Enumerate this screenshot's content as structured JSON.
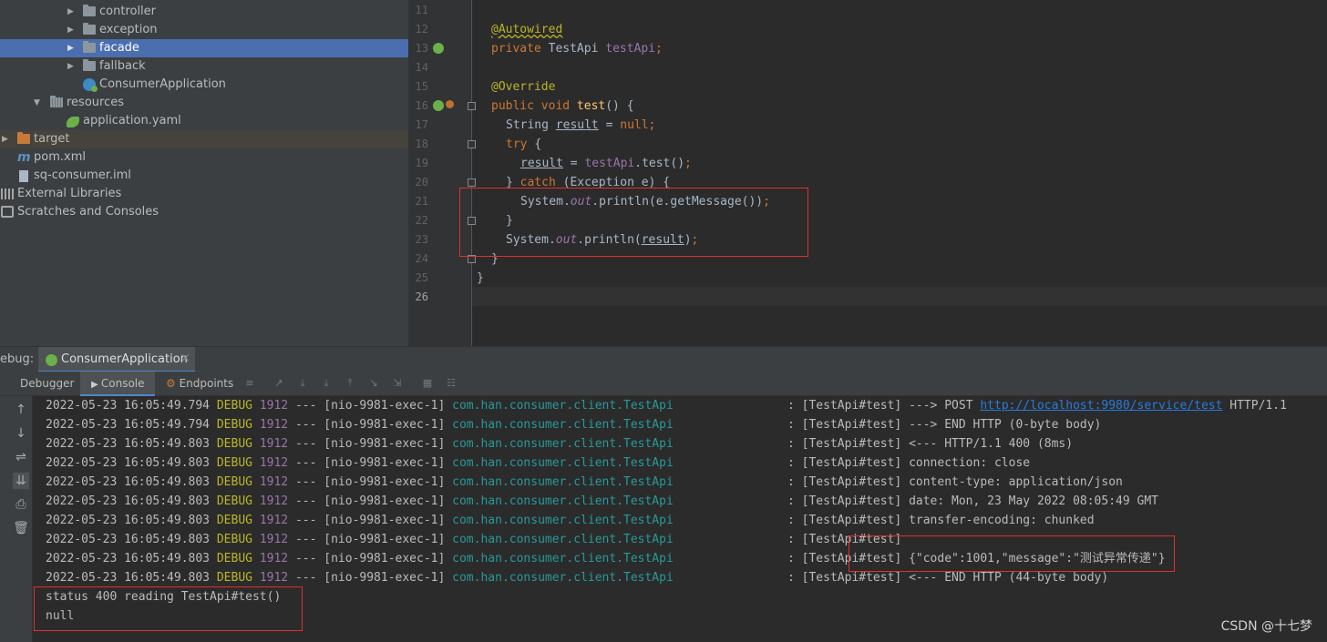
{
  "project_tree": [
    {
      "label": "controller",
      "kind": "folder",
      "expanded": false
    },
    {
      "label": "exception",
      "kind": "folder",
      "expanded": false
    },
    {
      "label": "facade",
      "kind": "folder",
      "expanded": false,
      "selected": true
    },
    {
      "label": "fallback",
      "kind": "folder",
      "expanded": false
    },
    {
      "label": "ConsumerApplication",
      "kind": "spring-class"
    },
    {
      "label": "resources",
      "kind": "resources-folder",
      "expanded": true
    },
    {
      "label": "application.yaml",
      "kind": "yaml"
    },
    {
      "label": "target",
      "kind": "excluded-folder",
      "expanded": false
    },
    {
      "label": "pom.xml",
      "kind": "maven"
    },
    {
      "label": "sq-consumer.iml",
      "kind": "iml"
    },
    {
      "label": "External Libraries",
      "kind": "libraries"
    },
    {
      "label": "Scratches and Consoles",
      "kind": "scratches"
    }
  ],
  "editor": {
    "line_numbers": [
      "11",
      "12",
      "13",
      "14",
      "15",
      "16",
      "17",
      "18",
      "19",
      "20",
      "21",
      "22",
      "23",
      "24",
      "25",
      "26"
    ]
  },
  "debug": {
    "label": "ebug:",
    "config_name": "ConsumerApplication",
    "close_glyph": "×",
    "tabs": [
      "Debugger",
      "Console",
      "Endpoints"
    ],
    "active_tab": "Console"
  },
  "console": {
    "logs": [
      {
        "ts": "2022-05-23 16:05:49.794",
        "level": "DEBUG",
        "pid": "1912",
        "thread": "--- [nio-9981-exec-1]",
        "logger": "com.han.consumer.client.TestApi",
        "sep": ":",
        "tag": "[TestApi#test]",
        "pre": "---> POST ",
        "link": "http://localhost:9980/service/test",
        "post": " HTTP/1.1"
      },
      {
        "ts": "2022-05-23 16:05:49.794",
        "level": "DEBUG",
        "pid": "1912",
        "thread": "--- [nio-9981-exec-1]",
        "logger": "com.han.consumer.client.TestApi",
        "sep": ":",
        "tag": "[TestApi#test]",
        "pre": "---> END HTTP (0-byte body)",
        "link": "",
        "post": ""
      },
      {
        "ts": "2022-05-23 16:05:49.803",
        "level": "DEBUG",
        "pid": "1912",
        "thread": "--- [nio-9981-exec-1]",
        "logger": "com.han.consumer.client.TestApi",
        "sep": ":",
        "tag": "[TestApi#test]",
        "pre": "<--- HTTP/1.1 400 (8ms)",
        "link": "",
        "post": ""
      },
      {
        "ts": "2022-05-23 16:05:49.803",
        "level": "DEBUG",
        "pid": "1912",
        "thread": "--- [nio-9981-exec-1]",
        "logger": "com.han.consumer.client.TestApi",
        "sep": ":",
        "tag": "[TestApi#test]",
        "pre": "connection: close",
        "link": "",
        "post": ""
      },
      {
        "ts": "2022-05-23 16:05:49.803",
        "level": "DEBUG",
        "pid": "1912",
        "thread": "--- [nio-9981-exec-1]",
        "logger": "com.han.consumer.client.TestApi",
        "sep": ":",
        "tag": "[TestApi#test]",
        "pre": "content-type: application/json",
        "link": "",
        "post": ""
      },
      {
        "ts": "2022-05-23 16:05:49.803",
        "level": "DEBUG",
        "pid": "1912",
        "thread": "--- [nio-9981-exec-1]",
        "logger": "com.han.consumer.client.TestApi",
        "sep": ":",
        "tag": "[TestApi#test]",
        "pre": "date: Mon, 23 May 2022 08:05:49 GMT",
        "link": "",
        "post": ""
      },
      {
        "ts": "2022-05-23 16:05:49.803",
        "level": "DEBUG",
        "pid": "1912",
        "thread": "--- [nio-9981-exec-1]",
        "logger": "com.han.consumer.client.TestApi",
        "sep": ":",
        "tag": "[TestApi#test]",
        "pre": "transfer-encoding: chunked",
        "link": "",
        "post": ""
      },
      {
        "ts": "2022-05-23 16:05:49.803",
        "level": "DEBUG",
        "pid": "1912",
        "thread": "--- [nio-9981-exec-1]",
        "logger": "com.han.consumer.client.TestApi",
        "sep": ":",
        "tag": "[TestApi#test]",
        "pre": "",
        "link": "",
        "post": ""
      },
      {
        "ts": "2022-05-23 16:05:49.803",
        "level": "DEBUG",
        "pid": "1912",
        "thread": "--- [nio-9981-exec-1]",
        "logger": "com.han.consumer.client.TestApi",
        "sep": ":",
        "tag": "[TestApi#test]",
        "pre": "{\"code\":1001,\"message\":\"测试异常传递\"}",
        "link": "",
        "post": ""
      },
      {
        "ts": "2022-05-23 16:05:49.803",
        "level": "DEBUG",
        "pid": "1912",
        "thread": "--- [nio-9981-exec-1]",
        "logger": "com.han.consumer.client.TestApi",
        "sep": ":",
        "tag": "[TestApi#test]",
        "pre": "<--- END HTTP (44-byte body)",
        "link": "",
        "post": ""
      }
    ],
    "output_lines": [
      "status 400 reading TestApi#test()",
      "null"
    ]
  },
  "watermark": "CSDN @十七梦",
  "colors": {
    "selection": "#4b6eaf",
    "keyword": "#cc7832",
    "annotation": "#bbb529",
    "logger": "#299999",
    "highlight_box": "#e03030"
  }
}
